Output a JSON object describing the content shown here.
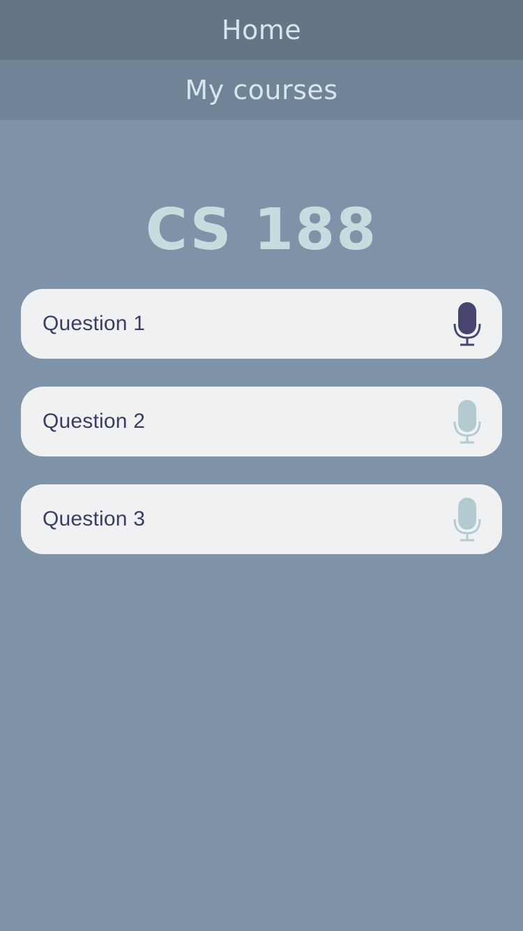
{
  "nav": {
    "home_label": "Home",
    "my_courses_label": "My courses"
  },
  "course": {
    "title": "CS 188"
  },
  "questions": [
    {
      "label": "Question 1",
      "icon": "microphone-icon",
      "state": "active"
    },
    {
      "label": "Question 2",
      "icon": "microphone-icon",
      "state": "inactive"
    },
    {
      "label": "Question 3",
      "icon": "microphone-icon",
      "state": "inactive"
    }
  ],
  "colors": {
    "background": "#7e93a8",
    "nav_home_bg": "#647586",
    "nav_courses_bg": "#718497",
    "title_text": "#c8dce0",
    "card_bg": "#f0f1f3",
    "question_text": "#3e3b62",
    "mic_active": "#46456f",
    "mic_inactive": "#b3cbd0"
  }
}
